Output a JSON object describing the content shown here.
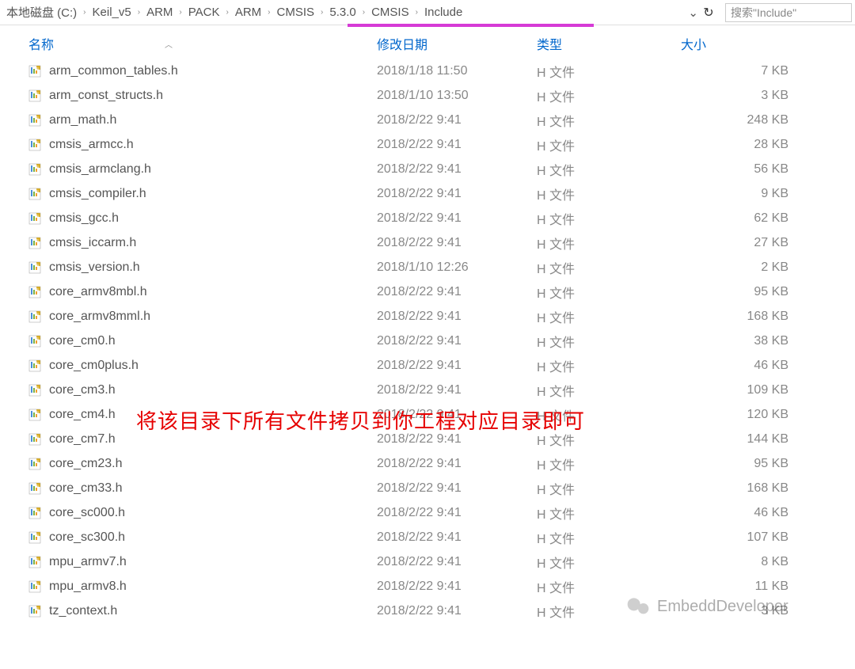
{
  "breadcrumb": {
    "items": [
      "本地磁盘 (C:)",
      "Keil_v5",
      "ARM",
      "PACK",
      "ARM",
      "CMSIS",
      "5.3.0",
      "CMSIS",
      "Include"
    ]
  },
  "search": {
    "placeholder": "搜索\"Include\""
  },
  "headers": {
    "name": "名称",
    "date": "修改日期",
    "type": "类型",
    "size": "大小"
  },
  "type_label": "H 文件",
  "files": [
    {
      "name": "arm_common_tables.h",
      "date": "2018/1/18 11:50",
      "size": "7 KB"
    },
    {
      "name": "arm_const_structs.h",
      "date": "2018/1/10 13:50",
      "size": "3 KB"
    },
    {
      "name": "arm_math.h",
      "date": "2018/2/22 9:41",
      "size": "248 KB"
    },
    {
      "name": "cmsis_armcc.h",
      "date": "2018/2/22 9:41",
      "size": "28 KB"
    },
    {
      "name": "cmsis_armclang.h",
      "date": "2018/2/22 9:41",
      "size": "56 KB"
    },
    {
      "name": "cmsis_compiler.h",
      "date": "2018/2/22 9:41",
      "size": "9 KB"
    },
    {
      "name": "cmsis_gcc.h",
      "date": "2018/2/22 9:41",
      "size": "62 KB"
    },
    {
      "name": "cmsis_iccarm.h",
      "date": "2018/2/22 9:41",
      "size": "27 KB"
    },
    {
      "name": "cmsis_version.h",
      "date": "2018/1/10 12:26",
      "size": "2 KB"
    },
    {
      "name": "core_armv8mbl.h",
      "date": "2018/2/22 9:41",
      "size": "95 KB"
    },
    {
      "name": "core_armv8mml.h",
      "date": "2018/2/22 9:41",
      "size": "168 KB"
    },
    {
      "name": "core_cm0.h",
      "date": "2018/2/22 9:41",
      "size": "38 KB"
    },
    {
      "name": "core_cm0plus.h",
      "date": "2018/2/22 9:41",
      "size": "46 KB"
    },
    {
      "name": "core_cm3.h",
      "date": "2018/2/22 9:41",
      "size": "109 KB"
    },
    {
      "name": "core_cm4.h",
      "date": "2018/2/22 9:41",
      "size": "120 KB"
    },
    {
      "name": "core_cm7.h",
      "date": "2018/2/22 9:41",
      "size": "144 KB"
    },
    {
      "name": "core_cm23.h",
      "date": "2018/2/22 9:41",
      "size": "95 KB"
    },
    {
      "name": "core_cm33.h",
      "date": "2018/2/22 9:41",
      "size": "168 KB"
    },
    {
      "name": "core_sc000.h",
      "date": "2018/2/22 9:41",
      "size": "46 KB"
    },
    {
      "name": "core_sc300.h",
      "date": "2018/2/22 9:41",
      "size": "107 KB"
    },
    {
      "name": "mpu_armv7.h",
      "date": "2018/2/22 9:41",
      "size": "8 KB"
    },
    {
      "name": "mpu_armv8.h",
      "date": "2018/2/22 9:41",
      "size": "11 KB"
    },
    {
      "name": "tz_context.h",
      "date": "2018/2/22 9:41",
      "size": "3 KB"
    }
  ],
  "annotation": "将该目录下所有文件拷贝到你工程对应目录即可",
  "watermark": "EmbeddDeveloper"
}
